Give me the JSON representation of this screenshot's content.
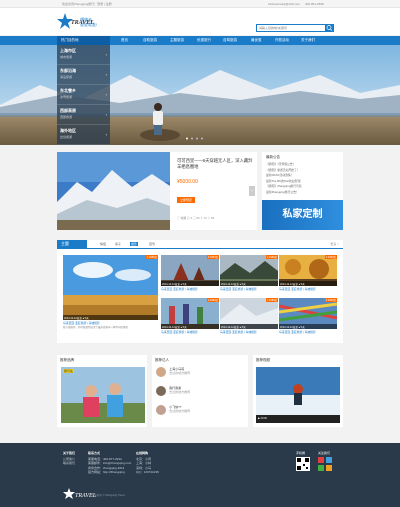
{
  "topbar": {
    "welcome": "欢迎访问Zhangqing旅行！登录 | 注册",
    "email": "fortbookmark@163.com",
    "phone": "400-851-1868"
  },
  "header": {
    "logo_text": "TRAVEL",
    "slogan_line1": "想旅去，",
    "slogan_line2": "说走就走!",
    "search_placeholder": "请输入目的地/关键词"
  },
  "nav": {
    "destinations": "热门目的地",
    "items": [
      "首页",
      "自助旅游",
      "主题旅游",
      "优惠旅行",
      "自驾旅游",
      "最优惠",
      "许愿活动",
      "关于我们"
    ]
  },
  "sidebar": [
    {
      "title": "上海市区",
      "sub": "城市旅游"
    },
    {
      "title": "东部沿海",
      "sub": "海岛旅游"
    },
    {
      "title": "东北雪乡",
      "sub": "冰雪旅游"
    },
    {
      "title": "西部高原",
      "sub": "西部旅游"
    },
    {
      "title": "海外地区",
      "sub": "出境旅游"
    }
  ],
  "feature": {
    "title": "可可西里——6天穿越无人区，深入藏羚羊栖息圈地",
    "price": "¥5000.00",
    "book_label": "立即预定",
    "stats": [
      "收藏",
      "5",
      "86",
      "10",
      "88"
    ]
  },
  "notice": {
    "title": "最新公告",
    "more": "更多 >",
    "items": [
      "【通知】7天年假公告！",
      "【通知】旅游活动开始了！",
      "最新MASS活动激情！",
      "最新The Biz的Taxi欢迎您到！",
      "【通知】Zhangqing旅行与您",
      "最新Zhangqing旅行公告！"
    ],
    "banner_text": "私家定制"
  },
  "theme": {
    "title": "主题",
    "more": "更多 >",
    "tabs": [
      "情侣",
      "亲子",
      "摄影",
      "自驾"
    ],
    "tiles": [
      {
        "price": "¥ 2980起",
        "date": "2014-12-12出发 ● 5天",
        "title": "马来西亚·亚庇旅游 | 海滩摄影"
      },
      {
        "price": "¥ 2980起",
        "date": "2014-12-12出发 ● 5天",
        "title": "马来西亚·亚庇旅游 | 海滩摄影"
      },
      {
        "price": "¥ 2980起",
        "date": "2014-12-12出发 ● 5天",
        "title": "马来西亚·亚庇旅游 | 海滩摄影"
      },
      {
        "price": "¥ 2980起",
        "date": "2014-12-12出发 ● 5天",
        "title": "马来西亚·亚庇旅游 | 海滩摄影"
      },
      {
        "price": "¥ 2980起",
        "date": "2014-12-12出发 ● 5天",
        "title": "马来西亚·亚庇旅游 | 海滩摄影"
      },
      {
        "price": "¥ 2980起",
        "date": "2014-12-12出发 ● 5天",
        "title": "马来西亚·亚庇旅游 | 海滩摄影"
      },
      {
        "price": "¥ 2980起",
        "date": "2014-12-12出发 ● 5天",
        "title": "马来西亚·亚庇旅游 | 海滩摄影"
      }
    ],
    "big_tile": {
      "price": "¥ 2980起",
      "date": "2014-12-12出发 ● 5天",
      "title": "马来西亚·亚庇旅游 | 海滩摄影",
      "desc": "我小编推荐，你可能要到这里了最多旅客中一种不同的体验"
    }
  },
  "bottom": {
    "left_title": "推荐品牌",
    "left_logo": "我们在",
    "mid_title": "推荐达人",
    "people": [
      {
        "name": "上海小马哥",
        "desc": "去过的地方推荐"
      },
      {
        "name": "我行我素",
        "desc": "去过的地方推荐"
      },
      {
        "name": "小飞侠??",
        "desc": "去过的地方推荐"
      }
    ],
    "right_title": "推荐视频",
    "video_time": "00:00"
  },
  "footer": {
    "cols": [
      {
        "title": "关于我们",
        "lines": [
          "公司简介",
          "联系我们"
        ]
      },
      {
        "title": "联系方式",
        "lines": [
          "客服电话：400-877-2932",
          "客服邮件：info@zhangqing.com",
          "商务合作：zhangqing 2014",
          "官方网站：http://Zhangqing"
        ]
      },
      {
        "title": "在线网购",
        "lines": [
          "北京：小周",
          "上海：小林",
          "深圳：小马",
          "QQ：123741238"
        ]
      }
    ],
    "follow": "关注我们",
    "wechat": "手机端",
    "copyright": "版权所有 © Zhangqing Travel"
  }
}
